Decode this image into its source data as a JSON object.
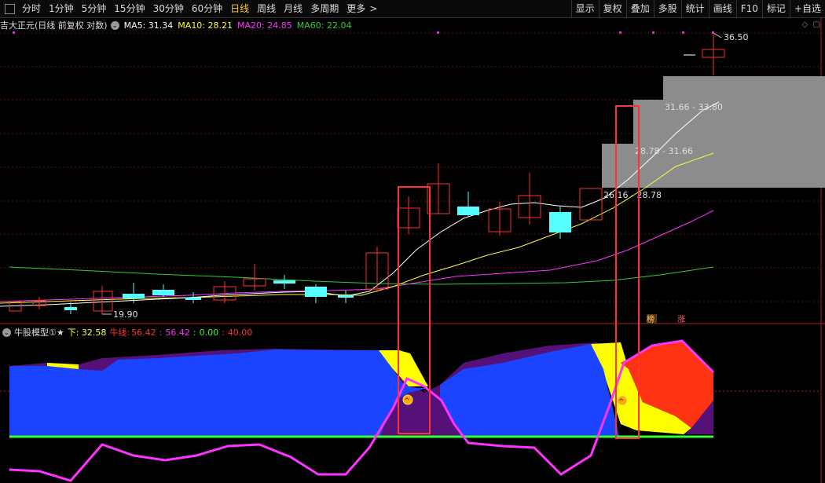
{
  "toolbar": {
    "periods": [
      "分时",
      "1分钟",
      "5分钟",
      "15分钟",
      "30分钟",
      "60分钟",
      "日线",
      "周线",
      "月线",
      "多周期",
      "更多"
    ],
    "active": "日线",
    "more_arrow": ">",
    "right_buttons": [
      "显示",
      "复权",
      "叠加",
      "多股",
      "统计",
      "画线",
      "F10",
      "标记",
      "+自选"
    ]
  },
  "main_info": {
    "stock": "吉大正元(日线 前复权 对数)",
    "ma5": "MA5: 31.34",
    "ma10": "MA10: 28.21",
    "ma20": "MA20: 24.85",
    "ma60": "MA60: 22.04"
  },
  "price_labels": {
    "high": "36.50",
    "low": "19.90",
    "zone1": "31.66 - 33.80",
    "zone2": "28.78 - 31.66",
    "zone3": "26.16 - 28.78"
  },
  "markers": {
    "bang": "榜",
    "zhang": "涨"
  },
  "indicator": {
    "name": "牛股模型①★",
    "down": "下: 32.58",
    "niu_label": "牛线:",
    "niu_value": "56.42",
    "sep1": ":",
    "v1": "56.42",
    "sep2": ":",
    "v2": "0.00",
    "sep3": ":",
    "v3": "40.00"
  },
  "colors": {
    "up": "#ff3333",
    "down": "#55ffff",
    "ma5": "#ffffff",
    "ma10": "#ffff33",
    "ma20": "#ff33ff",
    "ma60": "#33cc33",
    "blue": "#1a44ff",
    "purple": "#551177",
    "yellow": "#ffff00",
    "orange": "#ff3311",
    "magenta": "#ff33ff",
    "green": "#33ff33"
  }
}
